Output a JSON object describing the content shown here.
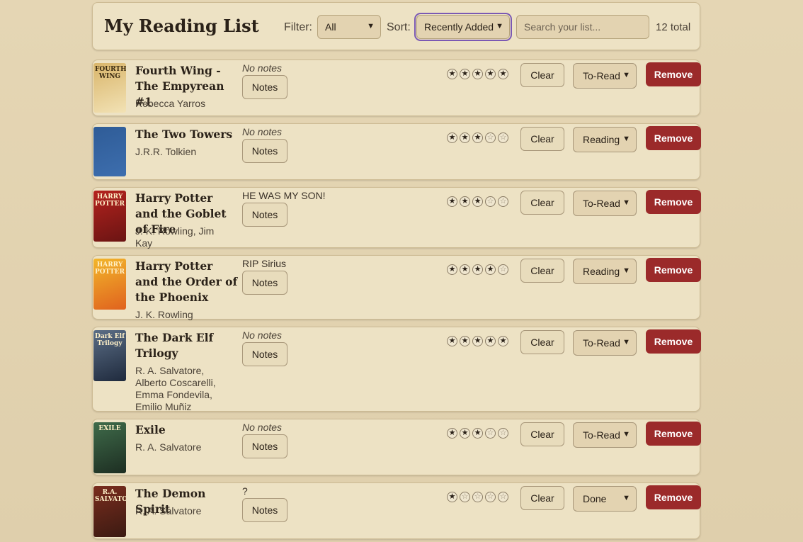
{
  "header": {
    "title": "My Reading List",
    "filter_label": "Filter:",
    "filter_value": "All",
    "sort_label": "Sort:",
    "sort_value": "Recently Added",
    "search_placeholder": "Search your list...",
    "total": "12 total"
  },
  "actions": {
    "notes_label": "Notes",
    "clear_label": "Clear",
    "remove_label": "Remove"
  },
  "books": [
    {
      "title": "Fourth Wing - The Empyrean #1",
      "author": "Rebecca Yarros",
      "note": "No notes",
      "note_empty": true,
      "rating": 5,
      "status": "To-Read",
      "cover_text": "FOURTH WING",
      "cover_colors": [
        "#d9b56a",
        "#f2e2b5"
      ]
    },
    {
      "title": "The Two Towers",
      "author": "J.R.R. Tolkien",
      "note": "No notes",
      "note_empty": true,
      "rating": 3,
      "status": "Reading",
      "cover_text": "",
      "cover_colors": [
        "#2f5c97",
        "#3d6eae"
      ]
    },
    {
      "title": "Harry Potter and the Goblet of Fire",
      "author": "J. K. Rowling, Jim Kay",
      "note": "HE WAS MY SON!",
      "note_empty": false,
      "rating": 3,
      "status": "To-Read",
      "cover_text": "HARRY POTTER",
      "cover_colors": [
        "#b5231e",
        "#6a1413"
      ]
    },
    {
      "title": "Harry Potter and the Order of the Phoenix",
      "author": "J. K. Rowling",
      "note": "RIP Sirius",
      "note_empty": false,
      "rating": 4,
      "status": "Reading",
      "cover_text": "HARRY POTTER",
      "cover_colors": [
        "#f2b62b",
        "#e0621e"
      ]
    },
    {
      "title": "The Dark Elf Trilogy",
      "author": "R. A. Salvatore, Alberto Coscarelli, Emma Fondevila, Emilio Muñiz",
      "note": "No notes",
      "note_empty": true,
      "rating": 5,
      "status": "To-Read",
      "cover_text": "Dark Elf Trilogy",
      "cover_colors": [
        "#5b6e86",
        "#1f2a3d"
      ]
    },
    {
      "title": "Exile",
      "author": "R. A. Salvatore",
      "note": "No notes",
      "note_empty": true,
      "rating": 3,
      "status": "To-Read",
      "cover_text": "EXILE",
      "cover_colors": [
        "#3f6b4a",
        "#1d2e22"
      ]
    },
    {
      "title": "The Demon Spirit",
      "author": "R. A. Salvatore",
      "note": "?",
      "note_empty": false,
      "rating": 1,
      "status": "Done",
      "cover_text": "R.A. SALVATORE",
      "cover_colors": [
        "#7a2d1e",
        "#3b1a12"
      ]
    }
  ]
}
